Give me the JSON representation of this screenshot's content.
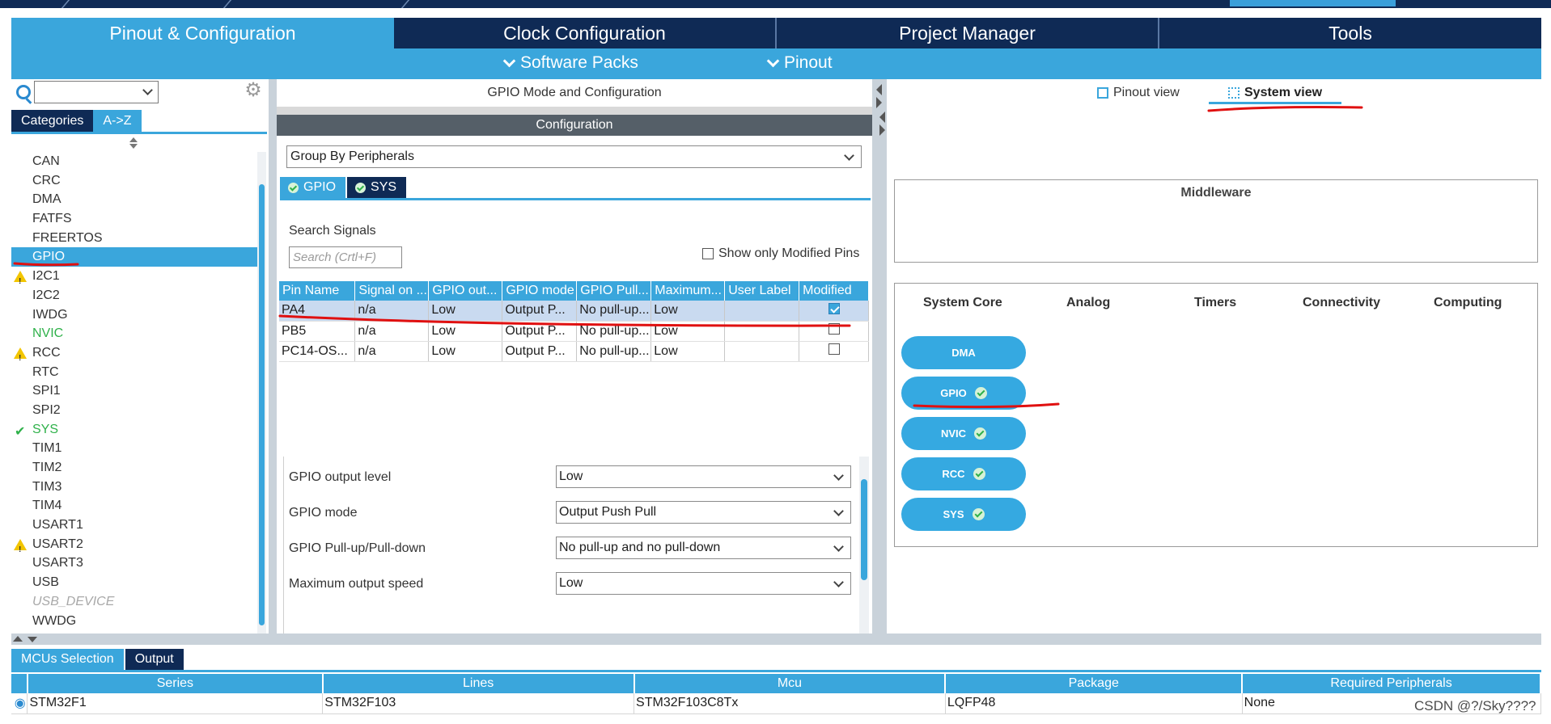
{
  "main_tabs": [
    {
      "label": "Pinout & Configuration",
      "active": true
    },
    {
      "label": "Clock Configuration",
      "active": false
    },
    {
      "label": "Project Manager",
      "active": false
    },
    {
      "label": "Tools",
      "active": false
    }
  ],
  "sub_bar": {
    "software_packs": "Software Packs",
    "pinout": "Pinout"
  },
  "left_panel": {
    "search_value": "",
    "tabs": [
      {
        "label": "Categories",
        "active": true
      },
      {
        "label": "A->Z",
        "active": false
      }
    ],
    "items": [
      {
        "label": "CAN",
        "state": "normal"
      },
      {
        "label": "CRC",
        "state": "normal"
      },
      {
        "label": "DMA",
        "state": "normal"
      },
      {
        "label": "FATFS",
        "state": "normal"
      },
      {
        "label": "FREERTOS",
        "state": "normal"
      },
      {
        "label": "GPIO",
        "state": "selected"
      },
      {
        "label": "I2C1",
        "state": "warning"
      },
      {
        "label": "I2C2",
        "state": "normal"
      },
      {
        "label": "IWDG",
        "state": "normal"
      },
      {
        "label": "NVIC",
        "state": "green"
      },
      {
        "label": "RCC",
        "state": "warning"
      },
      {
        "label": "RTC",
        "state": "normal"
      },
      {
        "label": "SPI1",
        "state": "normal"
      },
      {
        "label": "SPI2",
        "state": "normal"
      },
      {
        "label": "SYS",
        "state": "check"
      },
      {
        "label": "TIM1",
        "state": "normal"
      },
      {
        "label": "TIM2",
        "state": "normal"
      },
      {
        "label": "TIM3",
        "state": "normal"
      },
      {
        "label": "TIM4",
        "state": "normal"
      },
      {
        "label": "USART1",
        "state": "normal"
      },
      {
        "label": "USART2",
        "state": "warning"
      },
      {
        "label": "USART3",
        "state": "normal"
      },
      {
        "label": "USB",
        "state": "normal"
      },
      {
        "label": "USB_DEVICE",
        "state": "disabled"
      },
      {
        "label": "WWDG",
        "state": "normal"
      }
    ]
  },
  "middle_panel": {
    "title": "GPIO Mode and Configuration",
    "config_header": "Configuration",
    "group_by": "Group By Peripherals",
    "mode_tabs": [
      {
        "label": "GPIO",
        "active": true
      },
      {
        "label": "SYS",
        "active": false
      }
    ],
    "search_label": "Search Signals",
    "search_placeholder": "Search (Crtl+F)",
    "show_modified_label": "Show only Modified Pins",
    "columns": [
      "Pin Name",
      "Signal on ...",
      "GPIO out...",
      "GPIO mode",
      "GPIO Pull...",
      "Maximum...",
      "User Label",
      "Modified"
    ],
    "rows": [
      {
        "pin": "PA4",
        "signal": "n/a",
        "out": "Low",
        "mode": "Output P...",
        "pull": "No pull-up...",
        "max": "Low",
        "label": "",
        "modified": true,
        "selected": true
      },
      {
        "pin": "PB5",
        "signal": "n/a",
        "out": "Low",
        "mode": "Output P...",
        "pull": "No pull-up...",
        "max": "Low",
        "label": "",
        "modified": false,
        "selected": false
      },
      {
        "pin": "PC14-OS...",
        "signal": "n/a",
        "out": "Low",
        "mode": "Output P...",
        "pull": "No pull-up...",
        "max": "Low",
        "label": "",
        "modified": false,
        "selected": false
      }
    ],
    "params": [
      {
        "label": "GPIO output level",
        "value": "Low"
      },
      {
        "label": "GPIO mode",
        "value": "Output Push Pull"
      },
      {
        "label": "GPIO Pull-up/Pull-down",
        "value": "No pull-up and no pull-down"
      },
      {
        "label": "Maximum output speed",
        "value": "Low"
      }
    ]
  },
  "right_panel": {
    "pinout_view": "Pinout view",
    "system_view": "System view",
    "middleware_label": "Middleware",
    "columns": [
      "System Core",
      "Analog",
      "Timers",
      "Connectivity",
      "Computing"
    ],
    "core_buttons": [
      "DMA",
      "GPIO",
      "NVIC",
      "RCC",
      "SYS"
    ]
  },
  "bottom": {
    "tabs": [
      {
        "label": "MCUs Selection",
        "active": true
      },
      {
        "label": "Output",
        "active": false
      }
    ],
    "columns": [
      "Series",
      "Lines",
      "Mcu",
      "Package",
      "Required Peripherals"
    ],
    "row": {
      "series": "STM32F1",
      "lines": "STM32F103",
      "mcu": "STM32F103C8Tx",
      "package": "LQFP48",
      "peripherals": "None"
    }
  },
  "watermark": "CSDN @?/Sky????",
  "colors": {
    "accent": "#3aa6dc",
    "navy": "#0f2a55",
    "annotation_red": "#e01010",
    "ok_green": "#2fb14a",
    "warning": "#f2c500"
  }
}
